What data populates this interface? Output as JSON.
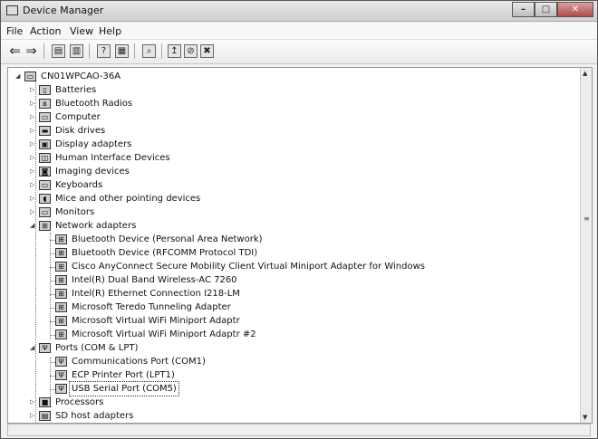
{
  "window": {
    "title": "Device Manager"
  },
  "menubar": {
    "items": [
      "File",
      "Action",
      "View",
      "Help"
    ]
  },
  "toolbar": {
    "buttons": [
      "back-icon",
      "forward-icon",
      "console-icon",
      "properties-icon",
      "help-icon",
      "show-hide-icon",
      "scan-icon",
      "update-driver-icon",
      "disable-icon",
      "uninstall-icon"
    ]
  },
  "tree": {
    "root": "CN01WPCAO-36A",
    "categories": [
      "Batteries",
      "Bluetooth Radios",
      "Computer",
      "Disk drives",
      "Display adapters",
      "Human Interface Devices",
      "Imaging devices",
      "Keyboards",
      "Mice and other pointing devices",
      "Monitors"
    ],
    "network_adapters": {
      "label": "Network adapters",
      "children": [
        "Bluetooth Device (Personal Area Network)",
        "Bluetooth Device (RFCOMM Protocol TDI)",
        "Cisco AnyConnect Secure Mobility Client Virtual Miniport Adapter for Windows",
        "Intel(R) Dual Band Wireless-AC 7260",
        "Intel(R) Ethernet Connection I218-LM",
        "Microsoft Teredo Tunneling Adapter",
        "Microsoft Virtual WiFi Miniport Adaptr",
        "Microsoft Virtual WiFi Miniport Adaptr #2"
      ]
    },
    "ports": {
      "label": "Ports (COM & LPT)",
      "children": [
        "Communications Port (COM1)",
        "ECP Printer Port (LPT1)",
        "USB Serial Port (COM5)"
      ],
      "selected": "USB Serial Port (COM5)"
    },
    "trailing": [
      "Processors",
      "SD host adapters"
    ]
  }
}
